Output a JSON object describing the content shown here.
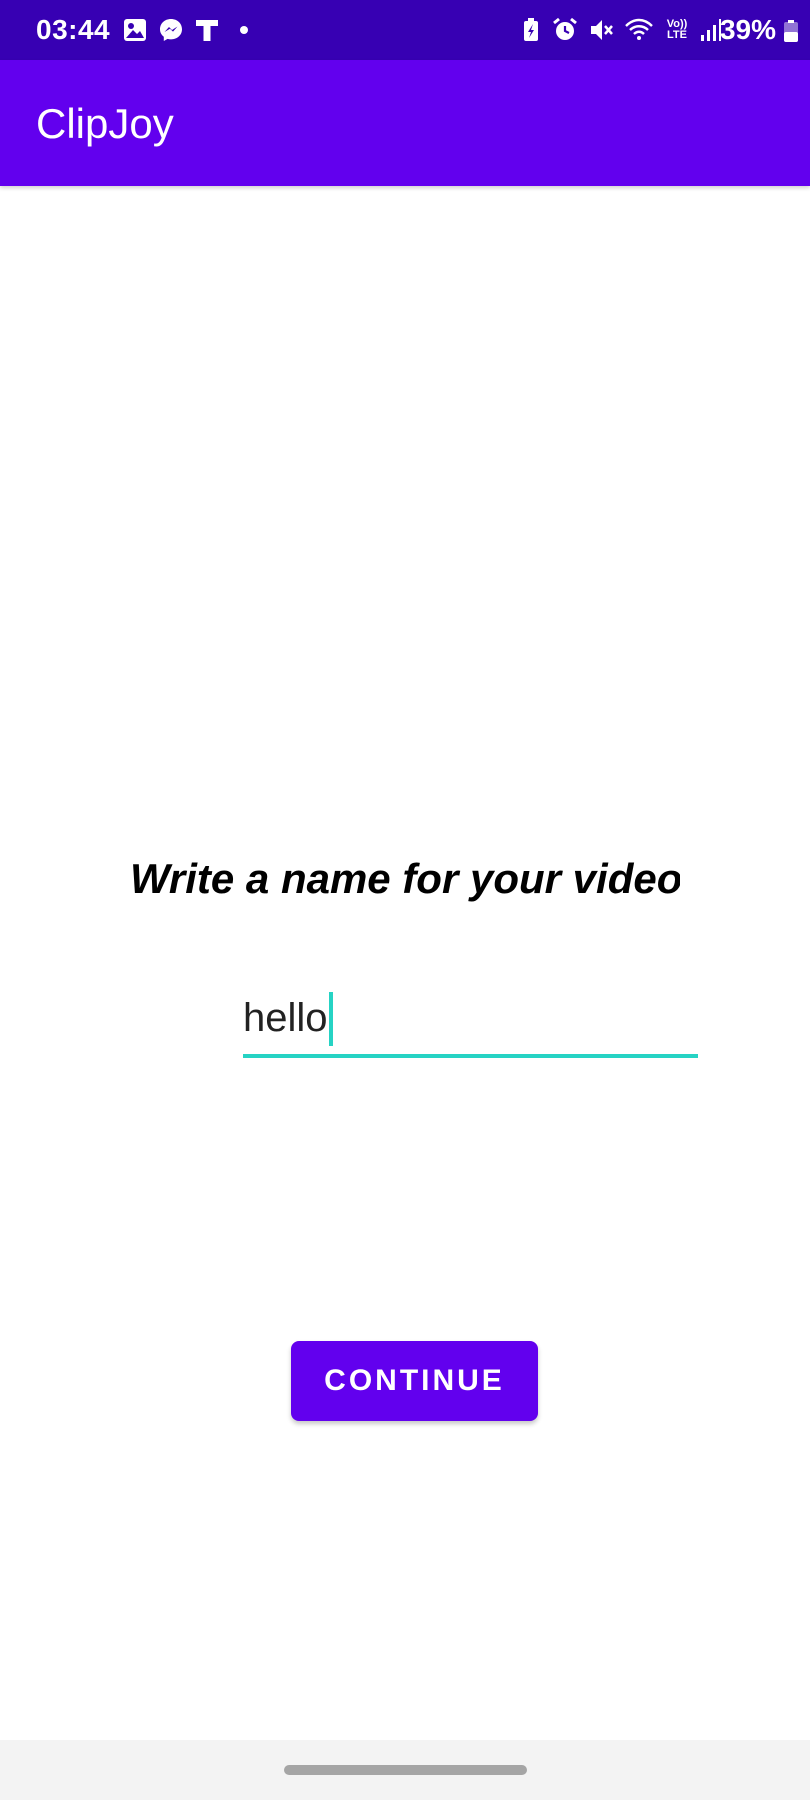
{
  "status_bar": {
    "time": "03:44",
    "battery_percent": "39%",
    "left_icons": [
      "image-icon",
      "messenger-icon",
      "t-icon",
      "dot-icon"
    ],
    "right_icons": [
      "battery-saver-icon",
      "alarm-icon",
      "mute-icon",
      "wifi-icon",
      "volte-icon",
      "signal-icon",
      "battery-icon"
    ],
    "volte_top": "Vo))",
    "volte_bottom": "LTE",
    "bg_color": "#3700b3"
  },
  "app_bar": {
    "title": "ClipJoy",
    "bg_color": "#6200ee"
  },
  "main": {
    "prompt": "Write a name for your video",
    "name_input": {
      "value": "hello",
      "underline_color": "#26d3c4"
    },
    "continue_label": "CONTINUE"
  },
  "nav_bar": {
    "handle": "home-pill"
  }
}
